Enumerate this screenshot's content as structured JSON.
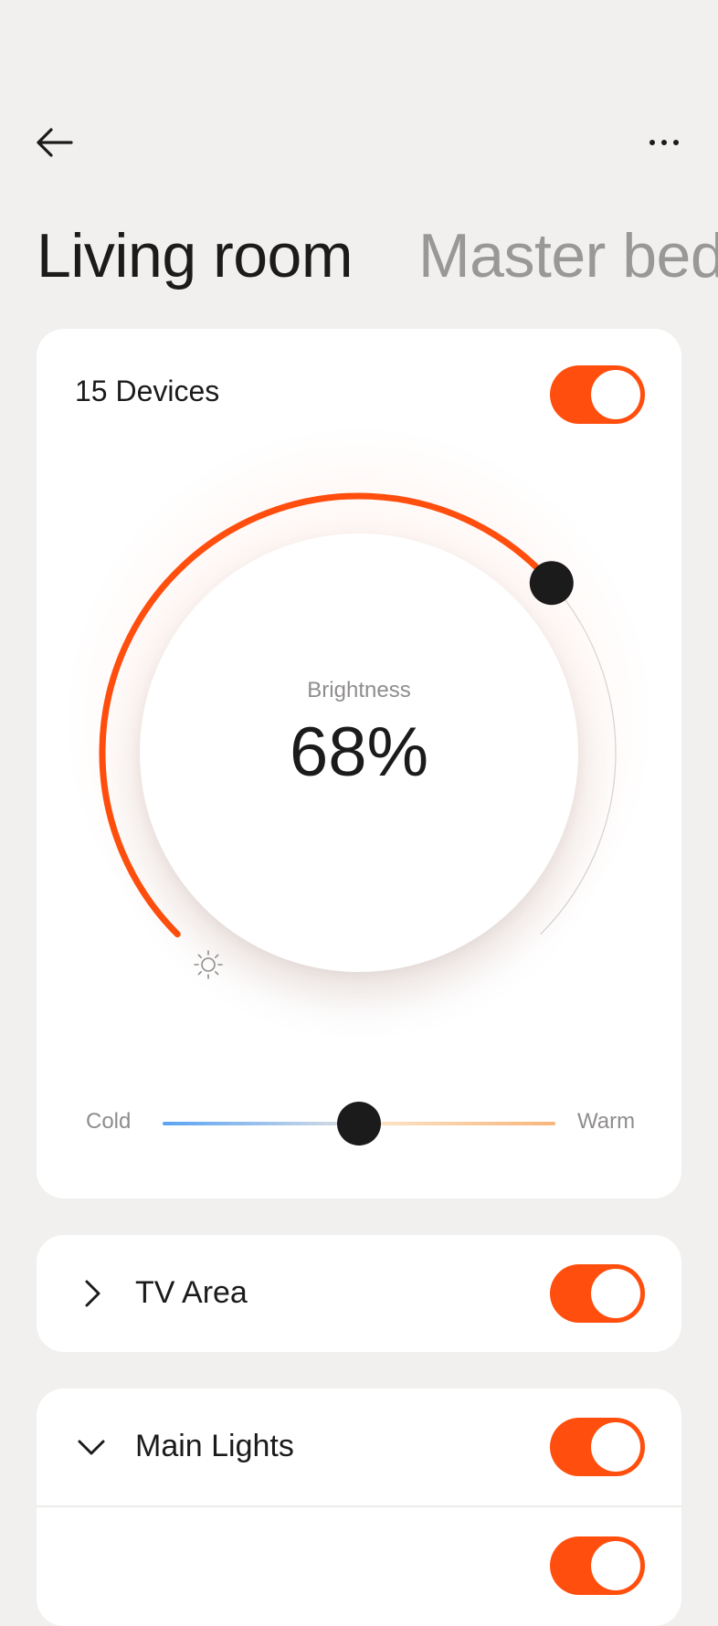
{
  "header": {
    "back_icon": "arrow-left-icon",
    "more_icon": "more-horizontal-icon"
  },
  "rooms": {
    "active": "Living room",
    "next": "Master bedroom"
  },
  "main_card": {
    "devices_label": "15 Devices",
    "power_on": true,
    "brightness_label": "Brightness",
    "brightness_value": "68%",
    "brightness_level": 0.68,
    "sun_icon": "sun-icon",
    "temperature": {
      "cold_label": "Cold",
      "warm_label": "Warm",
      "level": 0.5
    }
  },
  "groups": [
    {
      "label": "TV Area",
      "expanded": false,
      "on": true
    },
    {
      "label": "Main Lights",
      "expanded": true,
      "on": true
    }
  ],
  "colors": {
    "accent": "#ff4e0d",
    "background": "#f1f0ee",
    "card": "#ffffff",
    "text": "#1c1b1b",
    "muted": "#9a9897"
  }
}
